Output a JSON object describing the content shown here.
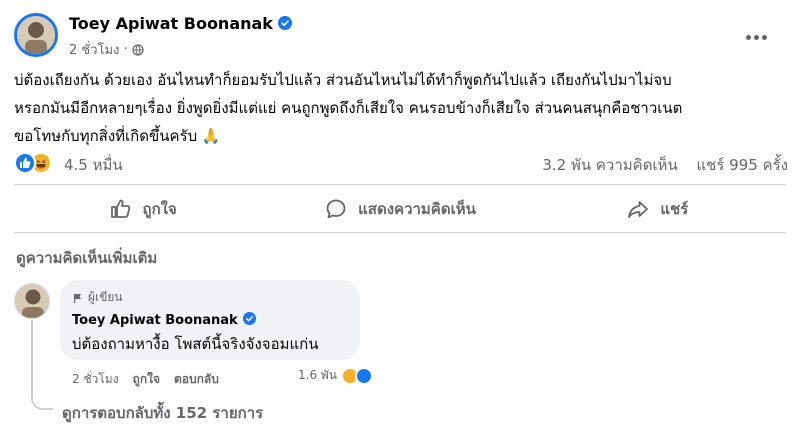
{
  "post": {
    "author": "Toey Apiwat Boonanak",
    "time": "2 ชั่วโมง",
    "text_lines": [
      "บ่ต้องเถียงกัน ด้วยเอง อันไหนทำก็ยอมรับไปแล้ว ส่วนอันไหนไม่ได้ทำก็พูดกันไปแล้ว เถียงกันไปมาไม่จบ",
      "หรอกมันมีอีกหลายๆเรื่อง ยิ่งพูดยิ่งมีแต่แย่ คนถูกพูดถึงก็เสียใจ คนรอบข้างก็เสียใจ ส่วนคนสนุกคือชาวเนต",
      "ขอโทษกับทุกสิ่งที่เกิดขึ้นครับ 🙏"
    ],
    "reactions_count": "4.5 หมื่น",
    "comments_count": "3.2 พัน ความคิดเห็น",
    "shares_count": "แชร์ 995 ครั้ง"
  },
  "actions": {
    "like": "ถูกใจ",
    "comment": "แสดงความคิดเห็น",
    "share": "แชร์"
  },
  "comments": {
    "more_label": "ดูความคิดเห็นเพิ่มเติม",
    "first": {
      "badge": "ผู้เขียน",
      "author": "Toey Apiwat Boonanak",
      "text": "บ่ต้องถามหางื้อ โพสต์นี้จริงจังจอมแก่น",
      "time": "2 ชั่วโมง",
      "like_label": "ถูกใจ",
      "reply_label": "ตอบกลับ",
      "reaction_count": "1.6 พัน"
    },
    "view_replies": "ดูการตอบกลับทั้ง 152 รายการ"
  },
  "colors": {
    "brand_blue": "#1877f2",
    "muted_text": "#65676b",
    "bubble_bg": "#f0f2f5",
    "haha_yellow": "#f7b125"
  },
  "icons": [
    "verified-badge-icon",
    "globe-icon",
    "more-dots-icon",
    "like-reaction-icon",
    "haha-reaction-icon",
    "thumbs-up-icon",
    "comment-bubble-icon",
    "share-arrow-icon",
    "author-badge-icon"
  ]
}
